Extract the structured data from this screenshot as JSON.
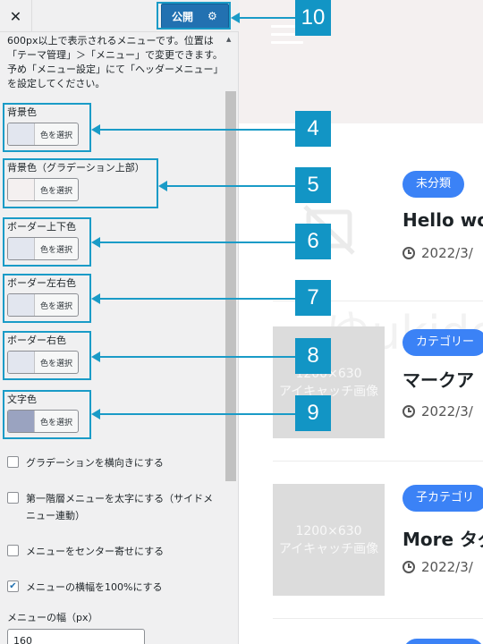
{
  "topbar": {
    "close_label": "✕",
    "publish_label": "公開",
    "settings_icon": "gear-icon"
  },
  "description": "600px以上で表示されるメニューです。位置は「テーマ管理」＞「メニュー」で変更できます。予め「メニュー設定」にて「ヘッダーメニュー」を設定してください。",
  "color_settings": [
    {
      "title": "背景色",
      "button_label": "色を選択",
      "swatch": "#e2e6ef"
    },
    {
      "title": "背景色（グラデーション上部）",
      "button_label": "色を選択",
      "swatch": "#f4f0f0"
    },
    {
      "title": "ボーダー上下色",
      "button_label": "色を選択",
      "swatch": "#e2e6ef"
    },
    {
      "title": "ボーダー左右色",
      "button_label": "色を選択",
      "swatch": "#e2e6ef"
    },
    {
      "title": "ボーダー右色",
      "button_label": "色を選択",
      "swatch": "#e2e6ef"
    },
    {
      "title": "文字色",
      "button_label": "色を選択",
      "swatch": "#9aa3c0"
    }
  ],
  "checkboxes": [
    {
      "label": "グラデーションを横向きにする",
      "checked": false
    },
    {
      "label": "第一階層メニューを太字にする（サイドメニュー連動）",
      "checked": false
    },
    {
      "label": "メニューをセンター寄せにする",
      "checked": false
    },
    {
      "label": "メニューの横幅を100%にする",
      "checked": true
    }
  ],
  "menu_width": {
    "title": "メニューの幅（px）",
    "value": "160"
  },
  "preview": {
    "watermark": "ゆukidoya",
    "posts": [
      {
        "category": "未分類",
        "title": "Hello wo",
        "date": "2022/3/",
        "thumb": "no-image-icon"
      },
      {
        "category": "カテゴリー",
        "title": "マークア",
        "date": "2022/3/",
        "thumb_lines": [
          "1200×630",
          "アイキャッチ画像"
        ]
      },
      {
        "category": "子カテゴリ",
        "title": "More タグ",
        "date": "2022/3/",
        "thumb_lines": [
          "1200×630",
          "アイキャッチ画像"
        ]
      }
    ]
  },
  "annotations": [
    "4",
    "5",
    "6",
    "7",
    "8",
    "9",
    "10"
  ],
  "colors": {
    "accent": "#1295c5",
    "publish": "#2271b1",
    "badge": "#3b82f6"
  }
}
